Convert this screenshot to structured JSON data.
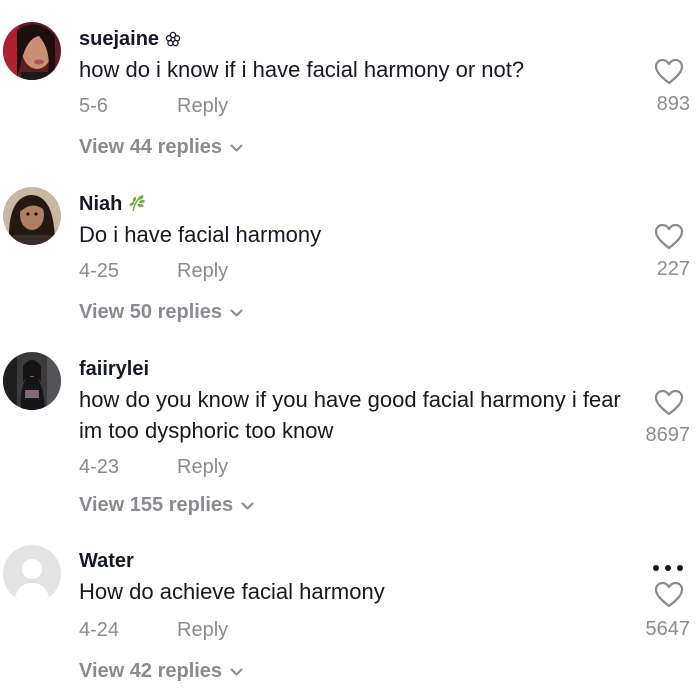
{
  "comments": [
    {
      "username": "suejaine",
      "username_icon": "flower-icon",
      "text": "how do i know if i have facial harmony or not?",
      "date": "5-6",
      "reply_label": "Reply",
      "likes": "893",
      "view_replies": "View 44 replies"
    },
    {
      "username": "Niah",
      "username_icon": "leaf-icon",
      "text": "Do i have facial harmony",
      "date": "4-25",
      "reply_label": "Reply",
      "likes": "227",
      "view_replies": "View 50 replies"
    },
    {
      "username": "faiirylei",
      "text": "how do you know if you have good facial harmony i fear im too dysphoric too know",
      "date": "4-23",
      "reply_label": "Reply",
      "likes": "8697",
      "view_replies": "View 155 replies"
    },
    {
      "username": "Water",
      "text": "How do achieve facial harmony",
      "date": "4-24",
      "reply_label": "Reply",
      "likes": "5647",
      "view_replies": "View 42 replies",
      "has_more_menu": true
    }
  ],
  "colors": {
    "text": "#161823",
    "muted": "#8a8b91",
    "leaf": "#6fae3a"
  }
}
